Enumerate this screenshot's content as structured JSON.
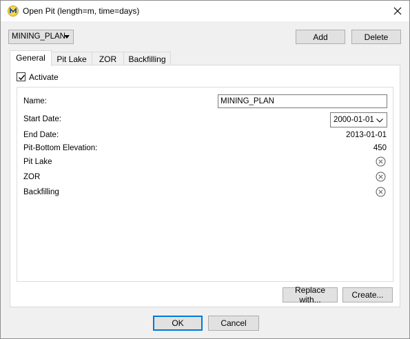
{
  "window": {
    "title": "Open Pit (length=m, time=days)",
    "icon": "mine-app-icon"
  },
  "toolbar": {
    "plan_select": "MINING_PLAN",
    "add_label": "Add",
    "delete_label": "Delete"
  },
  "tabs": [
    {
      "label": "General",
      "active": true
    },
    {
      "label": "Pit Lake",
      "active": false
    },
    {
      "label": "ZOR",
      "active": false
    },
    {
      "label": "Backfilling",
      "active": false
    }
  ],
  "general": {
    "activate_label": "Activate",
    "activate_checked": true,
    "name_label": "Name:",
    "name_value": "MINING_PLAN",
    "start_date_label": "Start Date:",
    "start_date_value": "2000-01-01",
    "end_date_label": "End Date:",
    "end_date_value": "2013-01-01",
    "pit_bottom_label": "Pit-Bottom Elevation:",
    "pit_bottom_value": "450",
    "pit_lake_label": "Pit Lake",
    "zor_label": "ZOR",
    "backfilling_label": "Backfilling",
    "status_icon": "disabled-circle-x-icon"
  },
  "panel_buttons": {
    "replace_label": "Replace with...",
    "create_label": "Create..."
  },
  "dialog_buttons": {
    "ok_label": "OK",
    "cancel_label": "Cancel"
  }
}
